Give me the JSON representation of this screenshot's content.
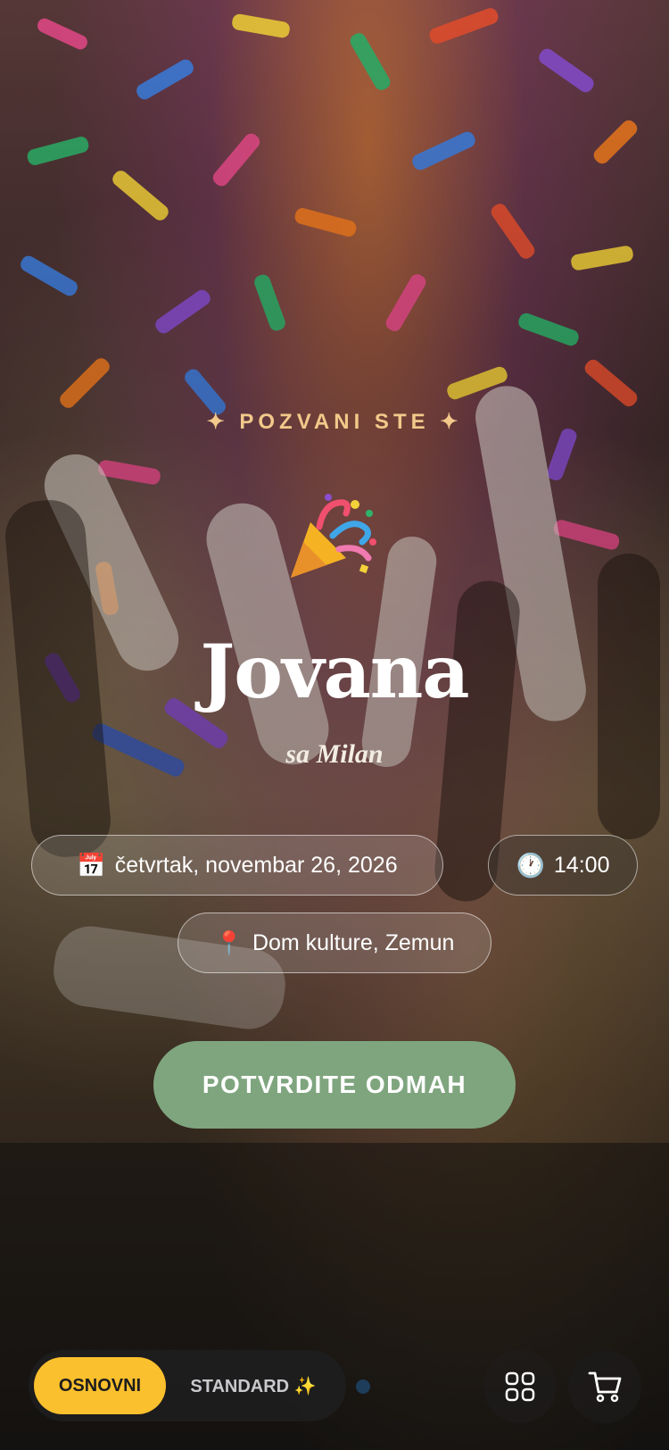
{
  "invite": {
    "eyebrow": "✦ POZVANI STE ✦",
    "party_icon": "party-popper-icon",
    "name": "Jovana",
    "partner": "sa Milan",
    "date_icon": "📅",
    "date": "četvrtak, novembar 26, 2026",
    "time_icon": "🕐",
    "time": "14:00",
    "location_icon": "📍",
    "location": "Dom kulture, Zemun",
    "cta_label": "POTVRDITE ODMAH"
  },
  "bottom_bar": {
    "tiers": [
      "OSNOVNI",
      "STANDARD ✨"
    ],
    "selected_tier": "OSNOVNI",
    "grid_icon": "grid-icon",
    "cart_icon": "cart-icon"
  },
  "colors": {
    "accent_gold": "#f2c98a",
    "cta_green": "#7fa57e",
    "tier_selected": "#fbc02d"
  }
}
